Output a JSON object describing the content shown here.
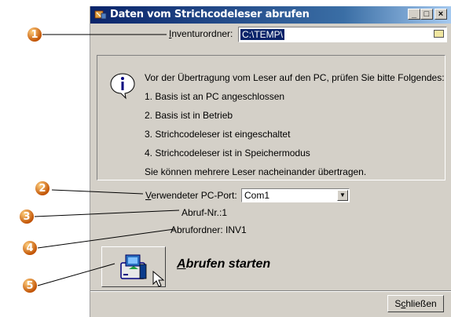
{
  "window": {
    "title": "Daten vom Strichcodeleser abrufen",
    "buttons": {
      "minimize": "_",
      "maximize": "□",
      "close": "×"
    }
  },
  "inventory": {
    "label_pre": "",
    "label_u": "I",
    "label_post": "nventurordner:",
    "value": "C:\\TEMP\\"
  },
  "info": {
    "lines": [
      "Vor der Übertragung vom Leser auf den PC, prüfen Sie bitte Folgendes:",
      "1. Basis ist an PC angeschlossen",
      "2. Basis ist in Betrieb",
      "3. Strichcodeleser ist eingeschaltet",
      "4. Strichcodeleser ist in Speichermodus",
      "Sie können mehrere Leser nacheinander übertragen."
    ]
  },
  "port": {
    "label_u": "V",
    "label_post": "erwendeter PC-Port:",
    "value": "Com1"
  },
  "retrieval": {
    "label": "Abruf-Nr.:1"
  },
  "folder": {
    "label": "Abrufordner: INV1"
  },
  "start": {
    "label_u": "A",
    "label_post": "brufen starten"
  },
  "close": {
    "label_pre": "S",
    "label_u": "c",
    "label_post": "hließen"
  },
  "callouts": [
    "1",
    "2",
    "3",
    "4",
    "5"
  ],
  "colors": {
    "titlebar": "#0a246a",
    "window": "#d4d0c8",
    "callout": "#e07818",
    "selection": "#0a246a"
  }
}
